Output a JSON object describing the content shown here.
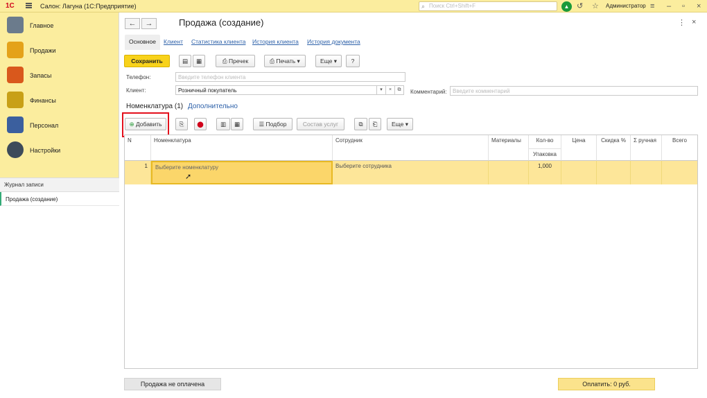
{
  "topbar": {
    "logo": "1С",
    "app_title": "Салон: Лагуна  (1С:Предприятие)",
    "search_placeholder": "Поиск Ctrl+Shift+F",
    "user": "Администратор"
  },
  "sidebar": {
    "items": [
      {
        "label": "Главное",
        "color": "#6b7b8c"
      },
      {
        "label": "Продажи",
        "color": "#e4a21a"
      },
      {
        "label": "Запасы",
        "color": "#d9581c"
      },
      {
        "label": "Финансы",
        "color": "#c8a017"
      },
      {
        "label": "Персонал",
        "color": "#3b5f9e"
      },
      {
        "label": "Настройки",
        "color": "#3d4b5a"
      }
    ],
    "journal_header": "Журнал записи",
    "journal_item": "Продажа (создание)"
  },
  "form": {
    "title": "Продажа (создание)",
    "tabs": [
      "Основное",
      "Клиент",
      "Статистика клиента",
      "История клиента",
      "История документа"
    ],
    "toolbar": {
      "save": "Сохранить",
      "precheck": "Пречек",
      "print": "Печать",
      "more": "Еще",
      "help": "?"
    },
    "phone_label": "Телефон:",
    "phone_placeholder": "Введите телефон клиента",
    "client_label": "Клиент:",
    "client_value": "Розничный покупатель",
    "comment_label": "Комментарий:",
    "comment_placeholder": "Введите комментарий",
    "subtabs": [
      "Номенклатура (1)",
      "Дополнительно"
    ],
    "table_toolbar": {
      "add": "Добавить",
      "select": "Подбор",
      "services": "Состав услуг",
      "more": "Еще"
    },
    "columns": [
      "N",
      "Номенклатура",
      "Сотрудник",
      "Материалы",
      "Кол-во",
      "Цена",
      "Скидка %",
      "Σ ручная",
      "Всего"
    ],
    "qty_sub": "Упаковка",
    "rows": [
      {
        "n": "1",
        "item": "Выберите номенклатуру",
        "employee": "Выберите сотрудника",
        "materials": "",
        "qty": "1,000",
        "price": "",
        "discount": "",
        "manual": "",
        "total": ""
      }
    ],
    "footer_status": "Продажа не оплачена",
    "footer_pay": "Оплатить: 0 руб."
  }
}
